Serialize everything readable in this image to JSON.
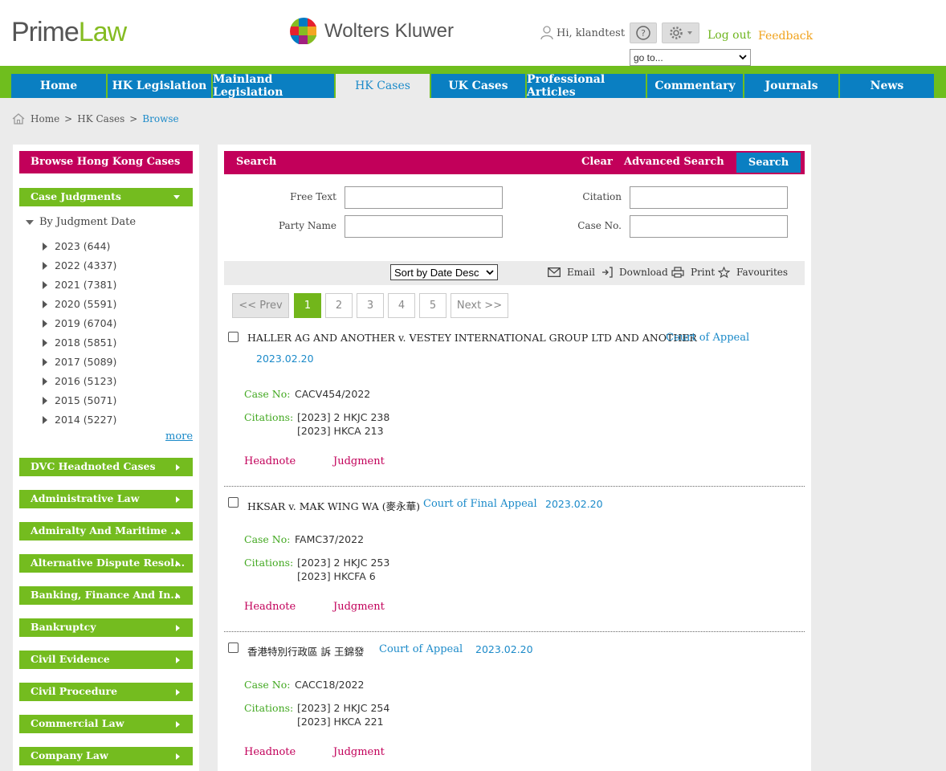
{
  "header": {
    "logo_part1": "Prime",
    "logo_part2": "Law",
    "publisher": "Wolters Kluwer",
    "greeting": "Hi, klandtest",
    "logout": "Log out",
    "feedback": "Feedback",
    "goto": "go to...",
    "icons": [
      "user-icon",
      "help-icon",
      "settings-icon"
    ]
  },
  "nav": {
    "tabs": [
      "Home",
      "HK Legislation",
      "Mainland Legislation",
      "HK Cases",
      "UK Cases",
      "Professional Articles",
      "Commentary",
      "Journals",
      "News"
    ],
    "active": "HK Cases"
  },
  "breadcrumb": [
    "Home",
    "HK Cases",
    "Browse"
  ],
  "sidebar": {
    "title": "Browse Hong Kong Cases",
    "case_judgments": "Case Judgments",
    "tree_root": "By Judgment Date",
    "years": [
      "2023 (644)",
      "2022 (4337)",
      "2021 (7381)",
      "2020 (5591)",
      "2019 (6704)",
      "2018 (5851)",
      "2017 (5089)",
      "2016 (5123)",
      "2015 (5071)",
      "2014 (5227)"
    ],
    "more": "more",
    "categories": [
      "DVC Headnoted Cases",
      "Administrative Law",
      "Admiralty And Maritime ...",
      "Alternative Dispute Resol...",
      "Banking, Finance And In...",
      "Bankruptcy",
      "Civil Evidence",
      "Civil Procedure",
      "Commercial Law",
      "Company Law"
    ]
  },
  "search": {
    "title": "Search",
    "clear": "Clear",
    "advanced": "Advanced Search",
    "button": "Search",
    "fields": {
      "free_text": "Free Text",
      "party_name": "Party Name",
      "citation": "Citation",
      "case_no": "Case No."
    }
  },
  "toolbar": {
    "sort": "Sort by Date Desc",
    "email": "Email",
    "download": "Download",
    "print": "Print",
    "favourites": "Favourites"
  },
  "pagination": {
    "prev": "<< Prev",
    "pages": [
      "1",
      "2",
      "3",
      "4",
      "5"
    ],
    "current": "1",
    "next": "Next >>"
  },
  "labels": {
    "case_no": "Case No:",
    "citations": "Citations:",
    "headnote": "Headnote",
    "judgment": "Judgment"
  },
  "cases": [
    {
      "title": "HALLER AG AND ANOTHER v. VESTEY INTERNATIONAL GROUP LTD AND ANOTHER",
      "court": "Court of Appeal",
      "date": "2023.02.20",
      "case_no": "CACV454/2022",
      "citations": [
        "[2023] 2 HKJC 238",
        "[2023] HKCA 213"
      ]
    },
    {
      "title": "HKSAR v. MAK WING WA (麥永華)",
      "court": "Court of Final Appeal",
      "date": "2023.02.20",
      "case_no": "FAMC37/2022",
      "citations": [
        "[2023] 2 HKJC 253",
        "[2023] HKCFA 6"
      ]
    },
    {
      "title": "香港特別行政區 訴 王錦發",
      "court": "Court of Appeal",
      "date": "2023.02.20",
      "case_no": "CACC18/2022",
      "citations": [
        "[2023] 2 HKJC 254",
        "[2023] HKCA 221"
      ]
    }
  ],
  "colors": {
    "brand_green": "#74bc1f",
    "nav_blue": "#0a7fc2",
    "magenta": "#c2005a",
    "link_blue": "#1b8ac9",
    "feedback_orange": "#f0a21b"
  }
}
